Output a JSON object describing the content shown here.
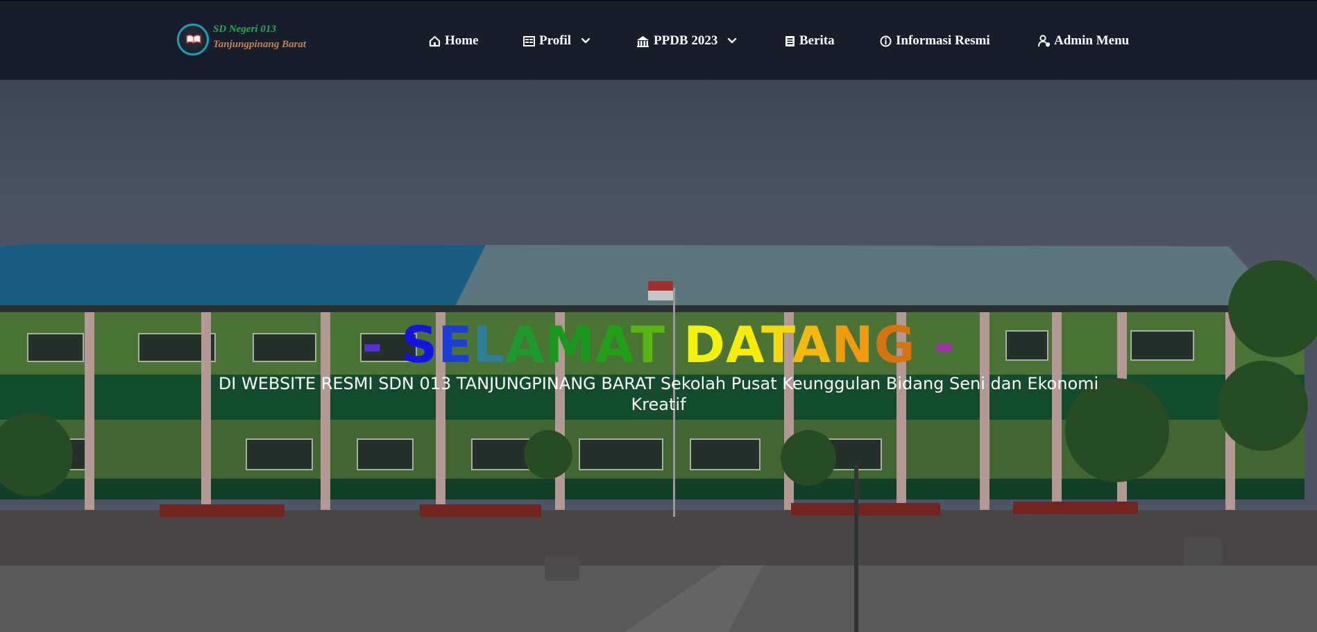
{
  "logo": {
    "line1": "SD Negeri 013",
    "line2": "Tanjungpinang Barat"
  },
  "nav": {
    "home": "Home",
    "profil": "Profil",
    "ppdb": "PPDB 2023",
    "berita": "Berita",
    "informasi": "Informasi Resmi",
    "admin": "Admin Menu"
  },
  "hero": {
    "title_letters": [
      {
        "ch": "-",
        "color": "#5b2fd8"
      },
      {
        "ch": " ",
        "color": "#ffffff"
      },
      {
        "ch": "S",
        "color": "#1414e0"
      },
      {
        "ch": "E",
        "color": "#1a3ed6"
      },
      {
        "ch": "L",
        "color": "#2f7f9a"
      },
      {
        "ch": "A",
        "color": "#1f9a2e"
      },
      {
        "ch": "M",
        "color": "#19991e"
      },
      {
        "ch": "A",
        "color": "#22a01a"
      },
      {
        "ch": "T",
        "color": "#58b514"
      },
      {
        "ch": " ",
        "color": "#ffffff"
      },
      {
        "ch": "D",
        "color": "#f4f20a"
      },
      {
        "ch": "A",
        "color": "#f6ec06"
      },
      {
        "ch": "T",
        "color": "#f7d808"
      },
      {
        "ch": "A",
        "color": "#f5b80c"
      },
      {
        "ch": "N",
        "color": "#f19a0e"
      },
      {
        "ch": "G",
        "color": "#d67410"
      },
      {
        "ch": " ",
        "color": "#ffffff"
      },
      {
        "ch": "-",
        "color": "#a52db0"
      }
    ],
    "subtitle": "DI WEBSITE RESMI SDN 013 TANJUNGPINANG BARAT Sekolah Pusat Keunggulan Bidang Seni dan Ekonomi Kreatif"
  },
  "colors": {
    "navbar_bg": "#171d2b",
    "nav_text": "#ffffff",
    "logo_green": "#1fae4f",
    "logo_orange": "#c8834d"
  },
  "icons": {
    "home": "home-icon",
    "profil": "table-icon",
    "ppdb": "school-icon",
    "berita": "newspaper-icon",
    "informasi": "info-circle-icon",
    "admin": "user-shield-icon",
    "dropdown": "chevron-down-icon"
  }
}
